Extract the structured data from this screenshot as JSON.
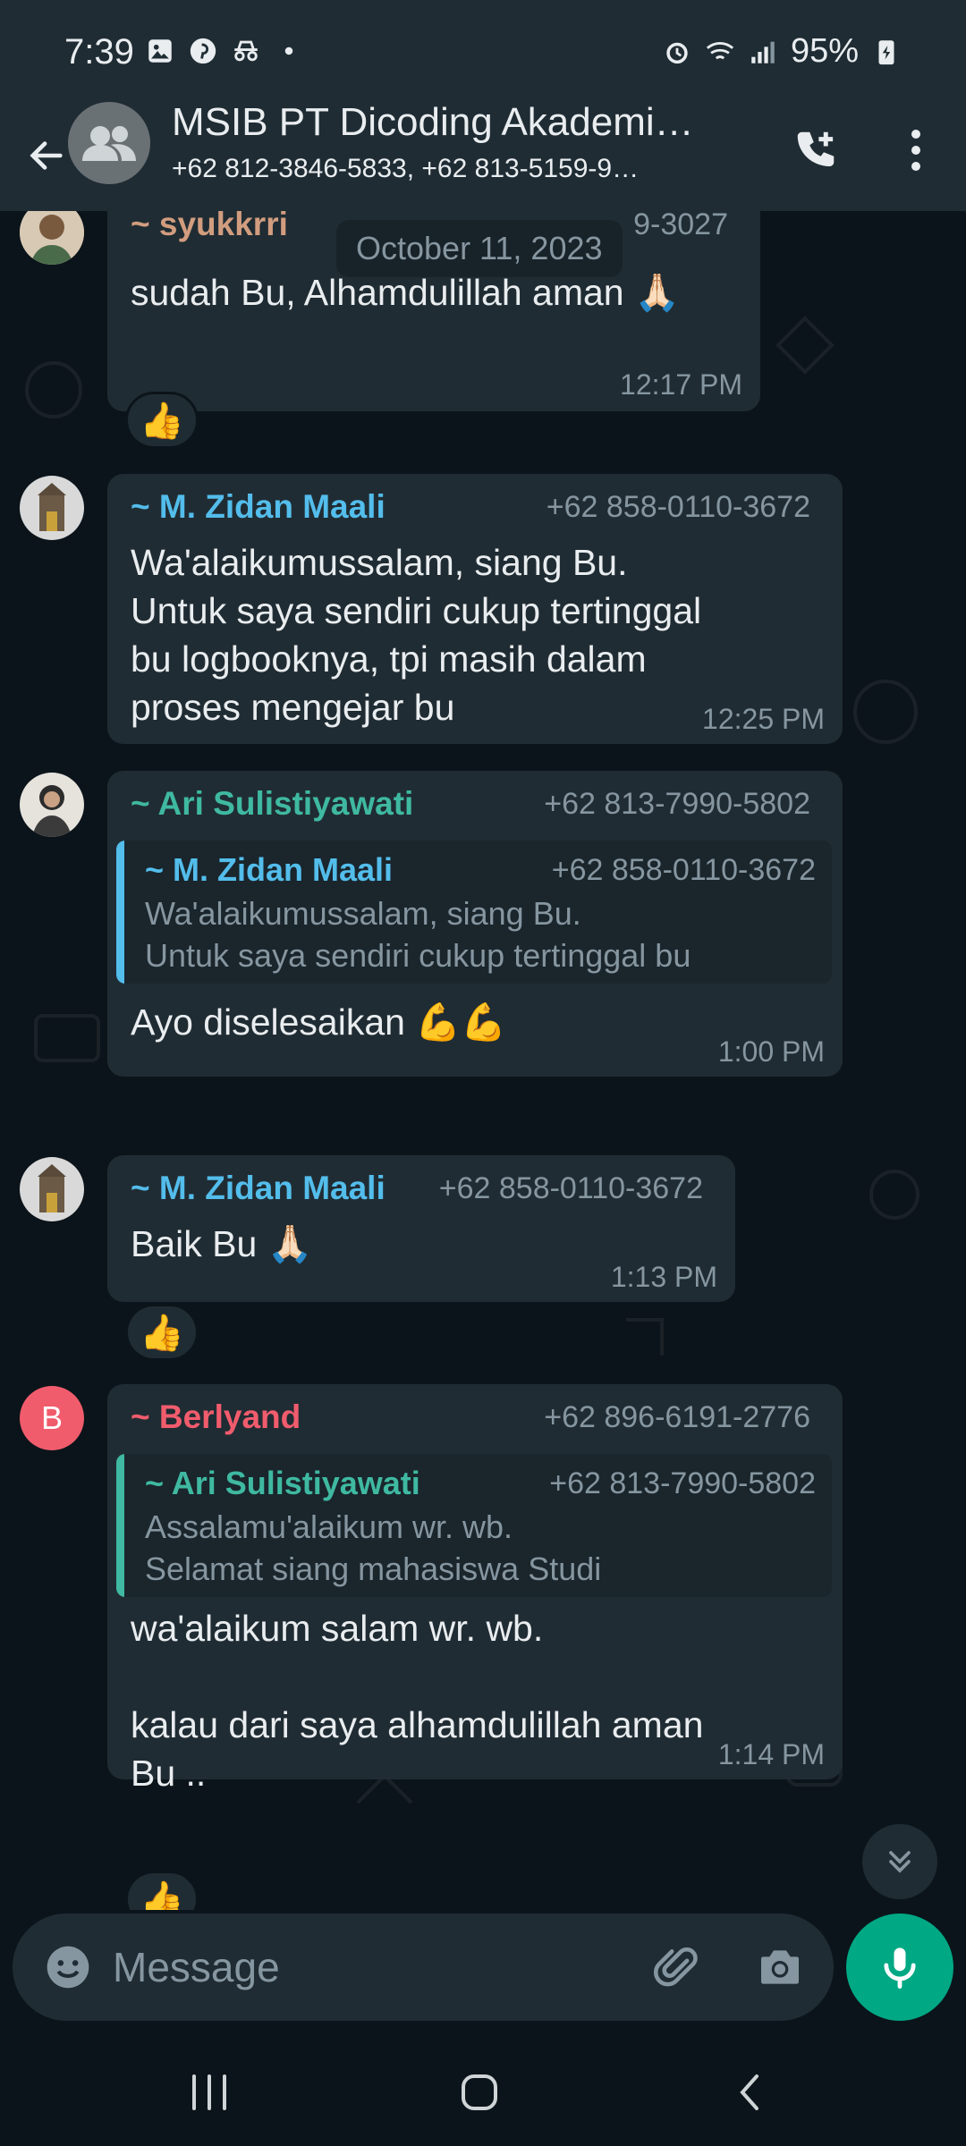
{
  "status_bar": {
    "time": "7:39",
    "battery": "95%",
    "left_icons": [
      "gallery-icon",
      "pinterest-icon",
      "incognito-icon",
      "dot-icon"
    ],
    "right_icons": [
      "alarm-icon",
      "wifi-icon",
      "signal-icon",
      "battery-charging-icon"
    ]
  },
  "header": {
    "title": "MSIB PT Dicoding Akademi…",
    "subtitle": "+62 812-3846-5833, +62 813-5159-9…"
  },
  "date_chip": "October 11, 2023",
  "messages": [
    {
      "sender": "~ syukkrri",
      "phone": "9-3027",
      "text": "sudah Bu, Alhamdulillah aman 🙏🏻",
      "time": "12:17 PM",
      "reaction": "👍"
    },
    {
      "sender": "~ M. Zidan Maali",
      "phone": "+62 858-0110-3672",
      "text": "Wa'alaikumussalam, siang Bu.\nUntuk saya sendiri cukup tertinggal\nbu logbooknya, tpi masih dalam\nproses mengejar bu",
      "time": "12:25 PM"
    },
    {
      "sender": "~ Ari Sulistiyawati",
      "phone": "+62 813-7990-5802",
      "quote": {
        "sender": "~ M. Zidan Maali",
        "phone": "+62 858-0110-3672",
        "text": "Wa'alaikumussalam, siang Bu.\nUntuk saya sendiri cukup tertinggal bu\nlogbooknya, tpi masih dalam proses me…"
      },
      "text": "Ayo diselesaikan 💪💪",
      "time": "1:00 PM"
    },
    {
      "sender": "~ M. Zidan Maali",
      "phone": "+62 858-0110-3672",
      "text": "Baik Bu 🙏🏻",
      "time": "1:13 PM",
      "reaction": "👍"
    },
    {
      "sender": "~ Berlyand",
      "phone": "+62 896-6191-2776",
      "avatar_letter": "B",
      "quote": {
        "sender": "~ Ari Sulistiyawati",
        "phone": "+62 813-7990-5802",
        "text": "Assalamu'alaikum wr. wb.\nSelamat siang mahasiswa Studi\nIndependen pada PT Dicoding Akademi I…"
      },
      "text": "wa'alaikum salam wr. wb.\n\nkalau dari saya alhamdulillah aman\nBu ..",
      "time": "1:14 PM",
      "reaction": "👍"
    }
  ],
  "input": {
    "placeholder": "Message"
  },
  "colors": {
    "app_bar": "#1f2c34",
    "background": "#0b141a",
    "bubble": "#202c33",
    "accent": "#00a884",
    "sender_syukkrri": "#d29d7f",
    "sender_zidan": "#53bdeb",
    "sender_ari": "#3fb9a1",
    "sender_berlyand": "#f15c6d",
    "meta_text": "#8696a0"
  }
}
